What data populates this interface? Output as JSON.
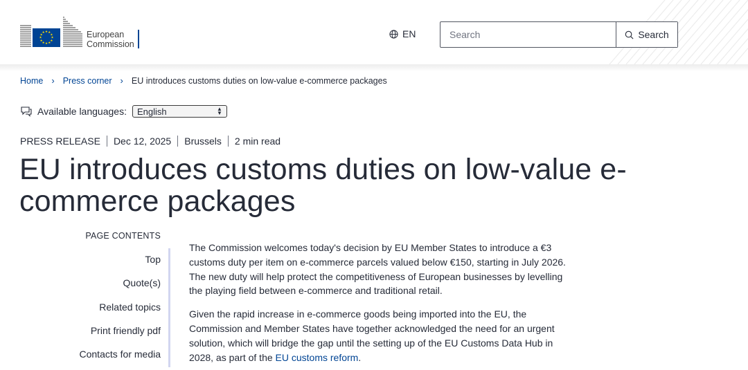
{
  "header": {
    "logo_line1": "European",
    "logo_line2": "Commission",
    "language_code": "EN",
    "search_placeholder": "Search",
    "search_button_label": "Search",
    "brand_color": "#004494",
    "flag_blue": "#004494",
    "flag_yellow": "#ffdd00"
  },
  "breadcrumb": {
    "items": [
      {
        "label": "Home"
      },
      {
        "label": "Press corner"
      }
    ],
    "current": "EU introduces customs duties on low-value e-commerce packages"
  },
  "languages": {
    "label": "Available languages:",
    "selected": "English"
  },
  "meta": {
    "type": "PRESS RELEASE",
    "date": "Dec 12, 2025",
    "location": "Brussels",
    "read_time": "2 min read"
  },
  "title_line1": "EU introduces customs duties on low-value e-",
  "title_line2": "commerce packages",
  "page_contents": {
    "heading": "PAGE CONTENTS",
    "items": [
      "Top",
      "Quote(s)",
      "Related topics",
      "Print friendly pdf",
      "Contacts for media"
    ]
  },
  "body": {
    "p1": "The Commission welcomes today's decision by EU Member States to introduce a €3 customs duty per item on e-commerce parcels valued below €150, starting in July 2026. The new duty will help protect the competitiveness of European businesses by levelling the playing field between e-commerce and traditional retail.",
    "p2_prefix": "Given the rapid increase in e-commerce goods being imported into the EU, the Commission and Member States have together acknowledged the need for an urgent solution, which will bridge the gap until the setting up of the EU Customs Data Hub in 2028, as part of the ",
    "p2_link": "EU customs reform",
    "p2_suffix": "."
  }
}
